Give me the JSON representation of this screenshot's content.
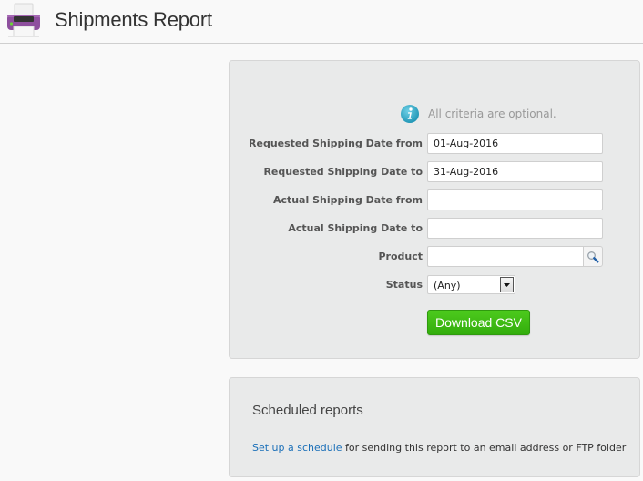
{
  "header": {
    "title": "Shipments Report",
    "icon": "printer-icon"
  },
  "criteria": {
    "info_icon": "info-icon",
    "info_text": "All criteria are optional.",
    "fields": [
      {
        "label": "Requested Shipping Date from",
        "value": "01-Aug-2016",
        "placeholder": ""
      },
      {
        "label": "Requested Shipping Date to",
        "value": "31-Aug-2016",
        "placeholder": ""
      },
      {
        "label": "Actual Shipping Date from",
        "value": "",
        "placeholder": ""
      },
      {
        "label": "Actual Shipping Date to",
        "value": "",
        "placeholder": ""
      },
      {
        "label": "Product",
        "value": "",
        "placeholder": "",
        "search_icon": "magnifier-icon"
      },
      {
        "label": "Status",
        "selected": "(Any)",
        "dropdown_icon": "dropdown-arrow-icon"
      }
    ],
    "download_button": "Download CSV"
  },
  "schedule": {
    "title": "Scheduled reports",
    "link_text": "Set up a schedule",
    "description": " for sending this report to an email address or FTP folder"
  },
  "colors": {
    "accent_green": "#3dbb14",
    "link_blue": "#1a6fb8",
    "panel_bg": "#e9eaea",
    "printer_purple": "#8e4f9e"
  }
}
